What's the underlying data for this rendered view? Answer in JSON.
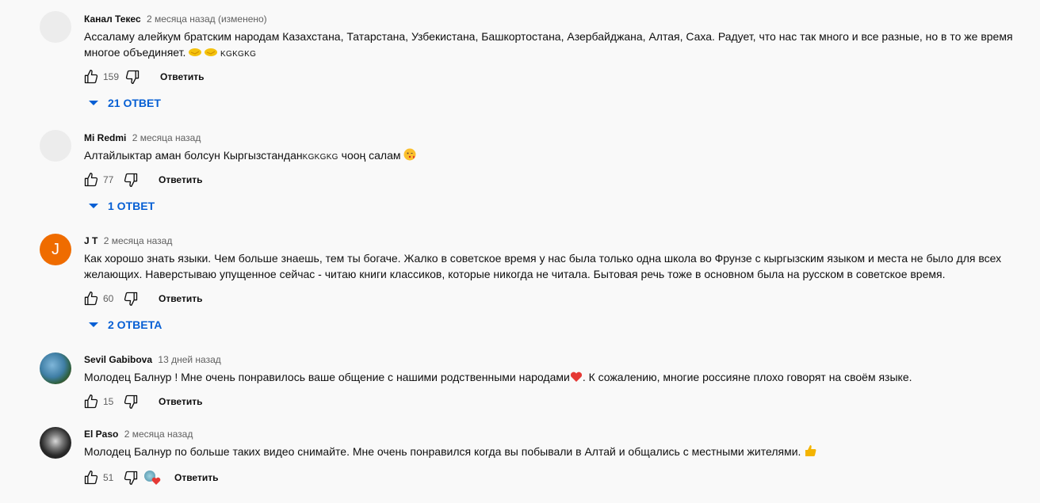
{
  "comments": [
    {
      "author": "Канал Текес",
      "meta": "2 месяца назад (изменено)",
      "text": "Ассаламу алейкум братским народам Казахстана, Татарстана, Узбекистана, Башкортостана, Азербайджана, Алтая, Саха. Радует, что нас так много и все разные, но в то же время многое объединяет.",
      "text_suffix": "KGKGKG",
      "likes": "159",
      "reply_label": "Ответить",
      "replies_label": "21 ОТВЕТ",
      "avatar_letter": ""
    },
    {
      "author": "Mi Redmi",
      "meta": "2 месяца назад",
      "text": "Алтайлыктар аман болсун Кыргызстандан",
      "text_small": "KGKGKG",
      "text_after": " чооң салам",
      "likes": "77",
      "reply_label": "Ответить",
      "replies_label": "1 ОТВЕТ",
      "avatar_letter": ""
    },
    {
      "author": "J T",
      "meta": "2 месяца назад",
      "text": "Как хорошо знать языки. Чем больше знаешь, тем ты богаче. Жалко в советское время у нас была только одна школа во Фрунзе с кыргызским языком и места не было для всех желающих. Наверстываю упущенное сейчас - читаю книги классиков, которые никогда не читала. Бытовая речь тоже в основном была на русском в советское время.",
      "likes": "60",
      "reply_label": "Ответить",
      "replies_label": "2 ОТВЕТА",
      "avatar_letter": "J"
    },
    {
      "author": "Sevil Gabibova",
      "meta": "13 дней назад",
      "text": "Молодец Балнур ! Мне очень понравилось ваше общение с нашими родственными народами",
      "text_after": ". К сожалению, многие россияне плохо говорят  на своём языке.",
      "likes": "15",
      "reply_label": "Ответить"
    },
    {
      "author": "El Paso",
      "meta": "2 месяца назад",
      "text": "Молодец Балнур по больше таких видео снимайте. Мне очень понравился когда вы побывали в Алтай и общались с местными жителями.",
      "likes": "51",
      "reply_label": "Ответить"
    }
  ],
  "colors": {
    "accent": "#065fd4",
    "letter_avatar": "#ef6c00",
    "heart": "#e53935"
  },
  "icons": [
    "like-icon",
    "dislike-icon",
    "expand-triangle-icon",
    "heart-icon",
    "handshake-emoji-icon",
    "kiss-emoji-icon",
    "thumbs-up-emoji-icon"
  ]
}
